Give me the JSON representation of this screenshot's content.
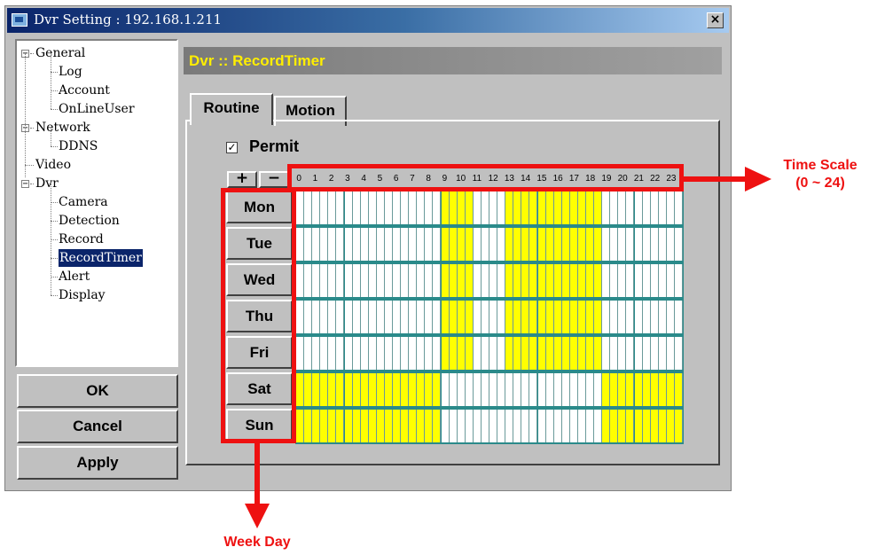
{
  "window": {
    "title": "Dvr Setting : 192.168.1.211",
    "close_label": "×"
  },
  "tree": {
    "nodes": [
      {
        "label": "General",
        "expander": "−"
      },
      {
        "label": "Log"
      },
      {
        "label": "Account"
      },
      {
        "label": "OnLineUser"
      },
      {
        "label": "Network",
        "expander": "−"
      },
      {
        "label": "DDNS"
      },
      {
        "label": "Video"
      },
      {
        "label": "Dvr",
        "expander": "−"
      },
      {
        "label": "Camera"
      },
      {
        "label": "Detection"
      },
      {
        "label": "Record"
      },
      {
        "label": "RecordTimer",
        "selected": true
      },
      {
        "label": "Alert"
      },
      {
        "label": "Display"
      }
    ]
  },
  "buttons": {
    "ok": "OK",
    "cancel": "Cancel",
    "apply": "Apply"
  },
  "header": {
    "title": "Dvr :: RecordTimer"
  },
  "tabs": [
    {
      "label": "Routine",
      "active": true
    },
    {
      "label": "Motion",
      "active": false
    }
  ],
  "permit": {
    "label": "Permit",
    "checked": true,
    "check_mark": "✓"
  },
  "scale_buttons": {
    "plus": "+",
    "minus": "−"
  },
  "hours": [
    "0",
    "1",
    "2",
    "3",
    "4",
    "5",
    "6",
    "7",
    "8",
    "9",
    "10",
    "11",
    "12",
    "13",
    "14",
    "15",
    "16",
    "17",
    "18",
    "19",
    "20",
    "21",
    "22",
    "23"
  ],
  "days": [
    "Mon",
    "Tue",
    "Wed",
    "Thu",
    "Fri",
    "Sat",
    "Sun"
  ],
  "schedule": {
    "weekday_active_hours": [
      [
        9,
        11
      ],
      [
        13,
        19
      ]
    ],
    "weekend_active_hours": [
      [
        0,
        9
      ],
      [
        19,
        24
      ]
    ],
    "active_color": "#ffff00",
    "inactive_color": "#ffffff",
    "grid_color": "#2a8a8a"
  },
  "annotations": {
    "time_scale": [
      "Time Scale",
      "(0 ~ 24)"
    ],
    "week_day": "Week Day",
    "color": "#ee1111"
  }
}
